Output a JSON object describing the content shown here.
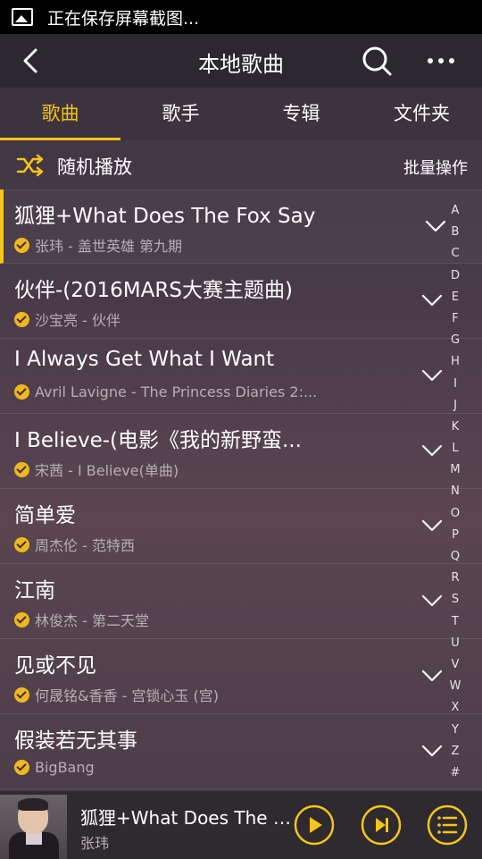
{
  "status_bar": {
    "notification": "正在保存屏幕截图..."
  },
  "header": {
    "title": "本地歌曲"
  },
  "tabs": [
    {
      "label": "歌曲",
      "active": true
    },
    {
      "label": "歌手",
      "active": false
    },
    {
      "label": "专辑",
      "active": false
    },
    {
      "label": "文件夹",
      "active": false
    }
  ],
  "toolbar": {
    "shuffle_label": "随机播放",
    "batch_label": "批量操作"
  },
  "songs": [
    {
      "title": "狐狸+What Does The Fox Say",
      "subtitle": "张玮 - 盖世英雄 第九期",
      "current": true
    },
    {
      "title": "伙伴-(2016MARS大赛主题曲)",
      "subtitle": "沙宝亮 - 伙伴"
    },
    {
      "title": "I Always Get What I Want",
      "subtitle": "Avril Lavigne - The Princess Diaries 2:..."
    },
    {
      "title": "I Believe-(电影《我的新野蛮...",
      "subtitle": "宋茜 - I Believe(单曲)"
    },
    {
      "title": "简单爱",
      "subtitle": "周杰伦 - 范特西"
    },
    {
      "title": "江南",
      "subtitle": "林俊杰 - 第二天堂"
    },
    {
      "title": "见或不见",
      "subtitle": "何晟铭&香香 - 宫锁心玉 (宫)"
    },
    {
      "title": "假装若无其事",
      "subtitle": "BigBang"
    }
  ],
  "alphabet": [
    "A",
    "B",
    "C",
    "D",
    "E",
    "F",
    "G",
    "H",
    "I",
    "J",
    "K",
    "L",
    "M",
    "N",
    "O",
    "P",
    "Q",
    "R",
    "S",
    "T",
    "U",
    "V",
    "W",
    "X",
    "Y",
    "Z",
    "#"
  ],
  "player": {
    "title": "狐狸+What Does The Fo...",
    "artist": "张玮"
  },
  "colors": {
    "accent": "#f5c518",
    "bar_bg": "#2c2830"
  }
}
